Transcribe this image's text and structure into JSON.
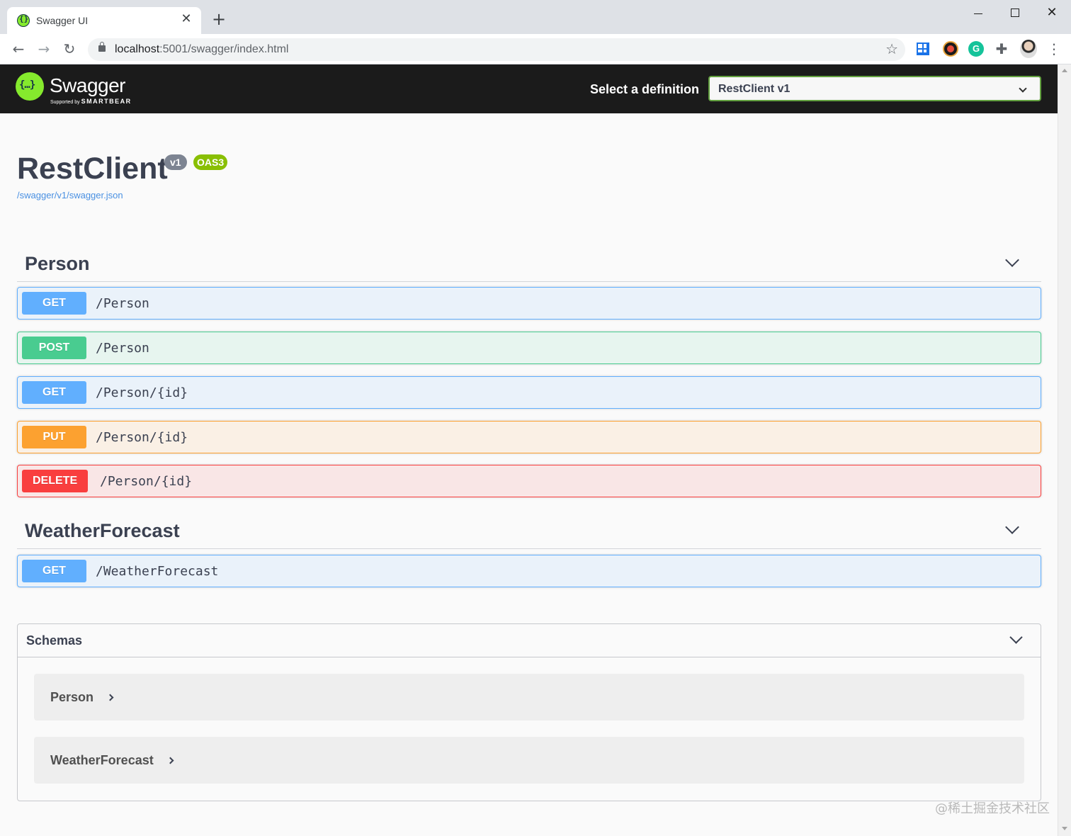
{
  "browser": {
    "tab_title": "Swagger UI",
    "tab_close": "✕",
    "new_tab": "+",
    "url_host": "localhost",
    "url_rest": ":5001/swagger/index.html",
    "icons": [
      "back-arrow-icon",
      "forward-arrow-icon",
      "reload-icon",
      "lock-icon",
      "star-icon",
      "grid-extension-icon",
      "clock-extension-icon",
      "grammarly-extension-icon",
      "puzzle-extension-icon",
      "profile-avatar",
      "kebab-menu-icon"
    ],
    "window_close": "✕"
  },
  "swagger": {
    "logo_text": "Swagger",
    "logo_sub_prefix": "Supported by",
    "logo_sub_brand": "SMARTBEAR",
    "select_label": "Select a definition",
    "selected_definition": "RestClient v1",
    "brand_color": "#85ea2d"
  },
  "info": {
    "title": "RestClient",
    "version_badge": "v1",
    "oas_badge": "OAS3",
    "spec_url": "/swagger/v1/swagger.json"
  },
  "tags": [
    {
      "name": "Person",
      "operations": [
        {
          "method": "GET",
          "path": "/Person"
        },
        {
          "method": "POST",
          "path": "/Person"
        },
        {
          "method": "GET",
          "path": "/Person/{id}"
        },
        {
          "method": "PUT",
          "path": "/Person/{id}"
        },
        {
          "method": "DELETE",
          "path": "/Person/{id}"
        }
      ]
    },
    {
      "name": "WeatherForecast",
      "operations": [
        {
          "method": "GET",
          "path": "/WeatherForecast"
        }
      ]
    }
  ],
  "method_colors": {
    "GET": "#61affe",
    "POST": "#49cc90",
    "PUT": "#fca130",
    "DELETE": "#f93e3e"
  },
  "schemas": {
    "title": "Schemas",
    "models": [
      "Person",
      "WeatherForecast"
    ]
  },
  "watermark": "@稀土掘金技术社区"
}
